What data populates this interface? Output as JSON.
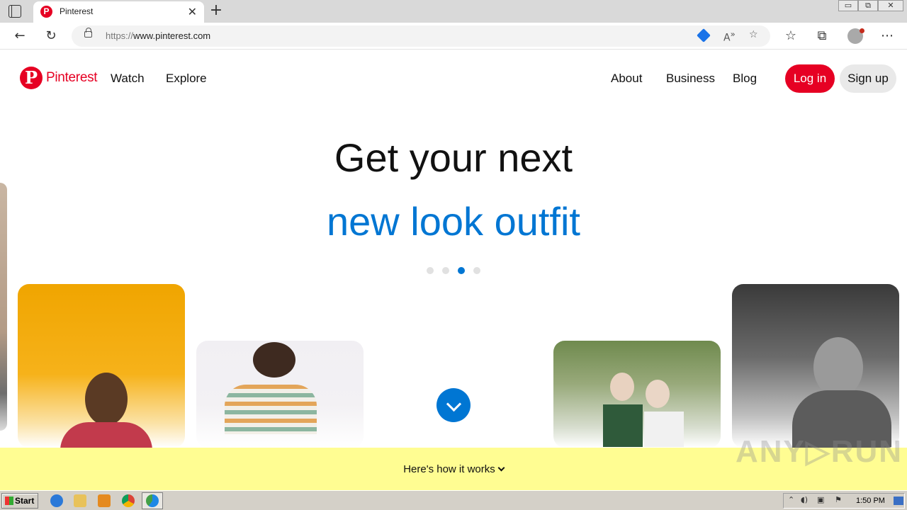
{
  "browser": {
    "tab_title": "Pinterest",
    "tab_favicon_letter": "P",
    "tab_close": "✕",
    "new_tab": "+",
    "url_prefix": "https://",
    "url_host": "www.pinterest.com",
    "window_controls": [
      "▭",
      "⧉",
      "✕"
    ],
    "read_aloud": "A",
    "read_aloud_sup": "»"
  },
  "site": {
    "brand": "Pinterest",
    "logo_letter": "P",
    "nav_left": [
      "Watch",
      "Explore"
    ],
    "nav_right": [
      "About",
      "Business",
      "Blog"
    ],
    "login_label": "Log in",
    "signup_label": "Sign up",
    "brand_color": "#e60023",
    "accent_color": "#0076d3"
  },
  "hero": {
    "line1": "Get your next",
    "line2": "new look outfit",
    "carousel_dots": 4,
    "active_dot": 2
  },
  "banner": {
    "text": "Here's how it works",
    "bg_color": "#fffd92"
  },
  "watermark": "ANY▷RUN",
  "taskbar": {
    "start_label": "Start",
    "clock": "1:50 PM"
  }
}
